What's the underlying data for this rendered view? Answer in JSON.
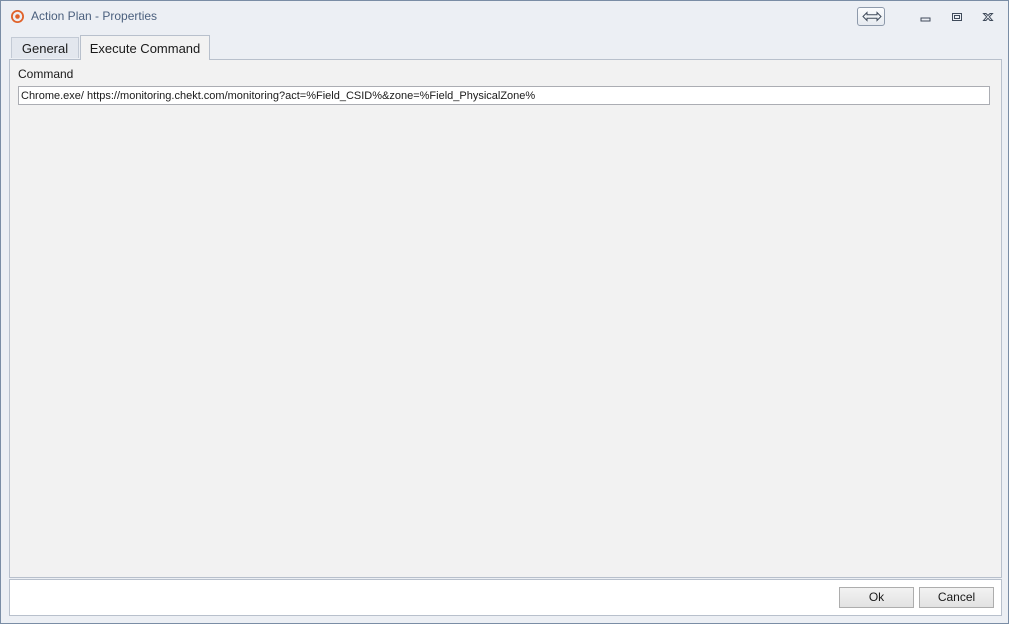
{
  "window": {
    "title": "Action Plan - Properties",
    "app_icon": "target-logo-icon",
    "controls": {
      "dock": "dock-arrows-icon",
      "minimize": "minimize-icon",
      "restore": "restore-icon",
      "close": "close-icon"
    }
  },
  "tabs": [
    {
      "label": "General",
      "selected": false
    },
    {
      "label": "Execute Command",
      "selected": true
    }
  ],
  "command": {
    "label": "Command",
    "value": "Chrome.exe/ https://monitoring.chekt.com/monitoring?act=%Field_CSID%&zone=%Field_PhysicalZone%"
  },
  "buttons": {
    "ok": "Ok",
    "cancel": "Cancel"
  },
  "colors": {
    "accent": "#e0622a",
    "title_text": "#4a5f7d"
  }
}
